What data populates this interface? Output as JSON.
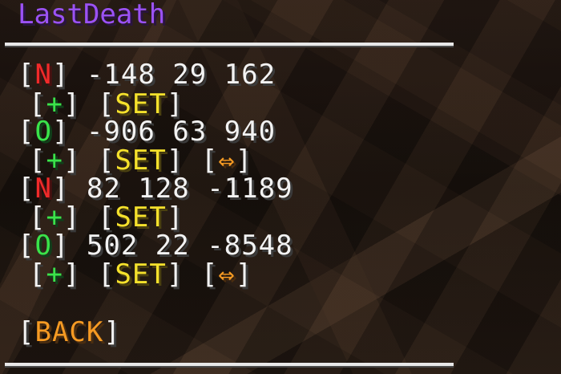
{
  "title": "LastDeath",
  "entries": [
    {
      "dim": "N",
      "coords": "-148 29 162",
      "add": "+",
      "set": "SET",
      "swap": ""
    },
    {
      "dim": "O",
      "coords": "-906 63 940",
      "add": "+",
      "set": "SET",
      "swap": "⇔"
    },
    {
      "dim": "N",
      "coords": "82 128 -1189",
      "add": "+",
      "set": "SET",
      "swap": ""
    },
    {
      "dim": "O",
      "coords": "502 22 -8548",
      "add": "+",
      "set": "SET",
      "swap": "⇔"
    }
  ],
  "back": "BACK",
  "colors": {
    "title": "#9b52f5",
    "nether": "#f12a2a",
    "overworld": "#3ae34a",
    "set": "#f5e12c",
    "swap": "#f59a23",
    "back": "#f59a23"
  }
}
